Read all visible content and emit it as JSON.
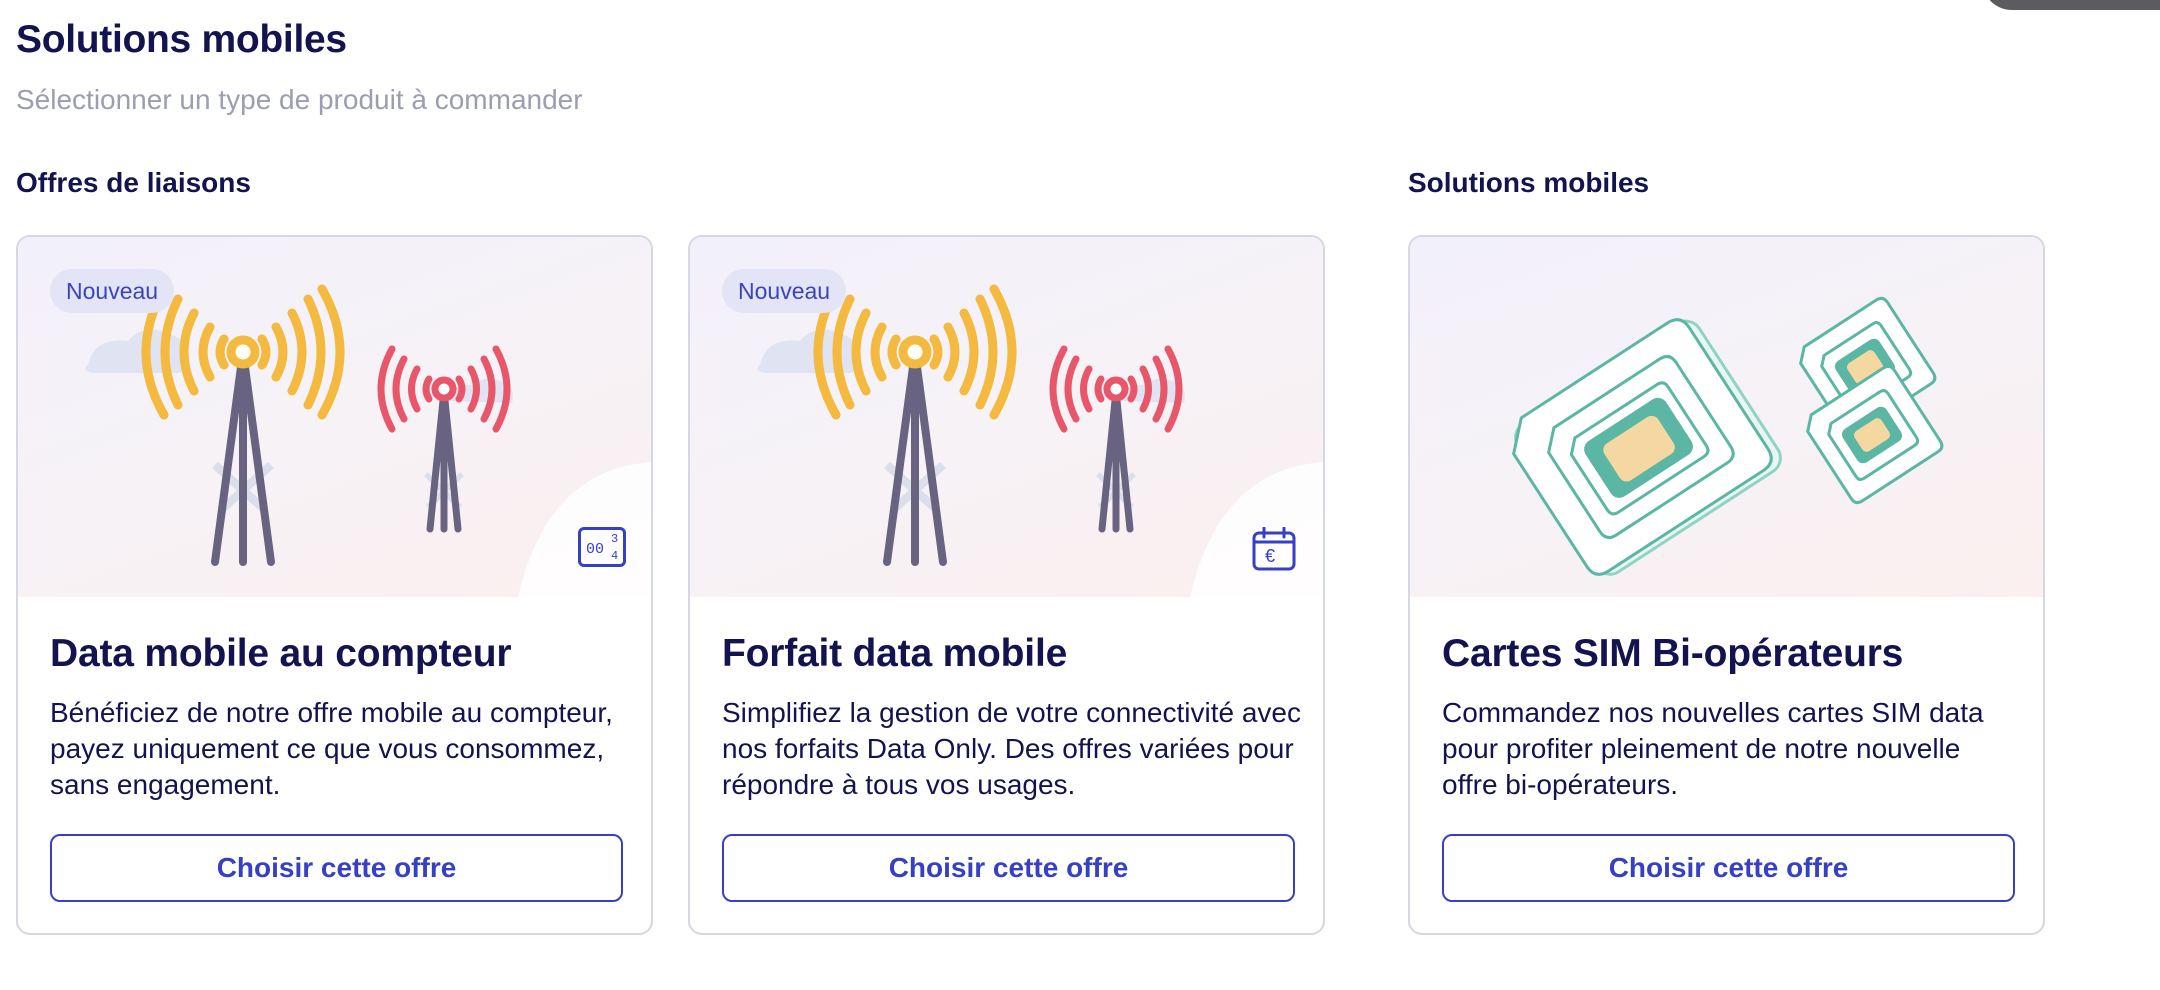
{
  "header": {
    "title": "Solutions mobiles",
    "subtitle": "Sélectionner un type de produit à commander"
  },
  "sections": [
    {
      "title": "Offres de liaisons"
    },
    {
      "title": "Solutions mobiles"
    }
  ],
  "cards": [
    {
      "badge": "Nouveau",
      "title": "Data mobile au compteur",
      "description": "Bénéficiez de notre offre mobile au compteur, payez uniquement ce que vous consommez, sans engagement.",
      "button": "Choisir cette offre",
      "corner_icon": "counter-icon",
      "counter_digits": "00",
      "counter_top": "3",
      "counter_bottom": "4"
    },
    {
      "badge": "Nouveau",
      "title": "Forfait data mobile",
      "description": "Simplifiez la gestion de votre connectivité avec nos forfaits Data Only. Des offres variées pour répondre à tous vos usages.",
      "button": "Choisir cette offre",
      "corner_icon": "calendar-euro-icon",
      "currency": "€"
    },
    {
      "title": "Cartes SIM Bi-opérateurs",
      "description": "Commandez nos nouvelles cartes SIM data pour profiter pleinement de notre nouvelle offre bi-opérateurs.",
      "button": "Choisir cette offre"
    }
  ],
  "colors": {
    "accent": "#3540c5",
    "title": "#13144f",
    "antenna_large": "#f4b93f",
    "antenna_small": "#e8566a",
    "tower": "#676381",
    "sim_green": "#5bb7a3",
    "sim_chip": "#f5d7a1"
  }
}
